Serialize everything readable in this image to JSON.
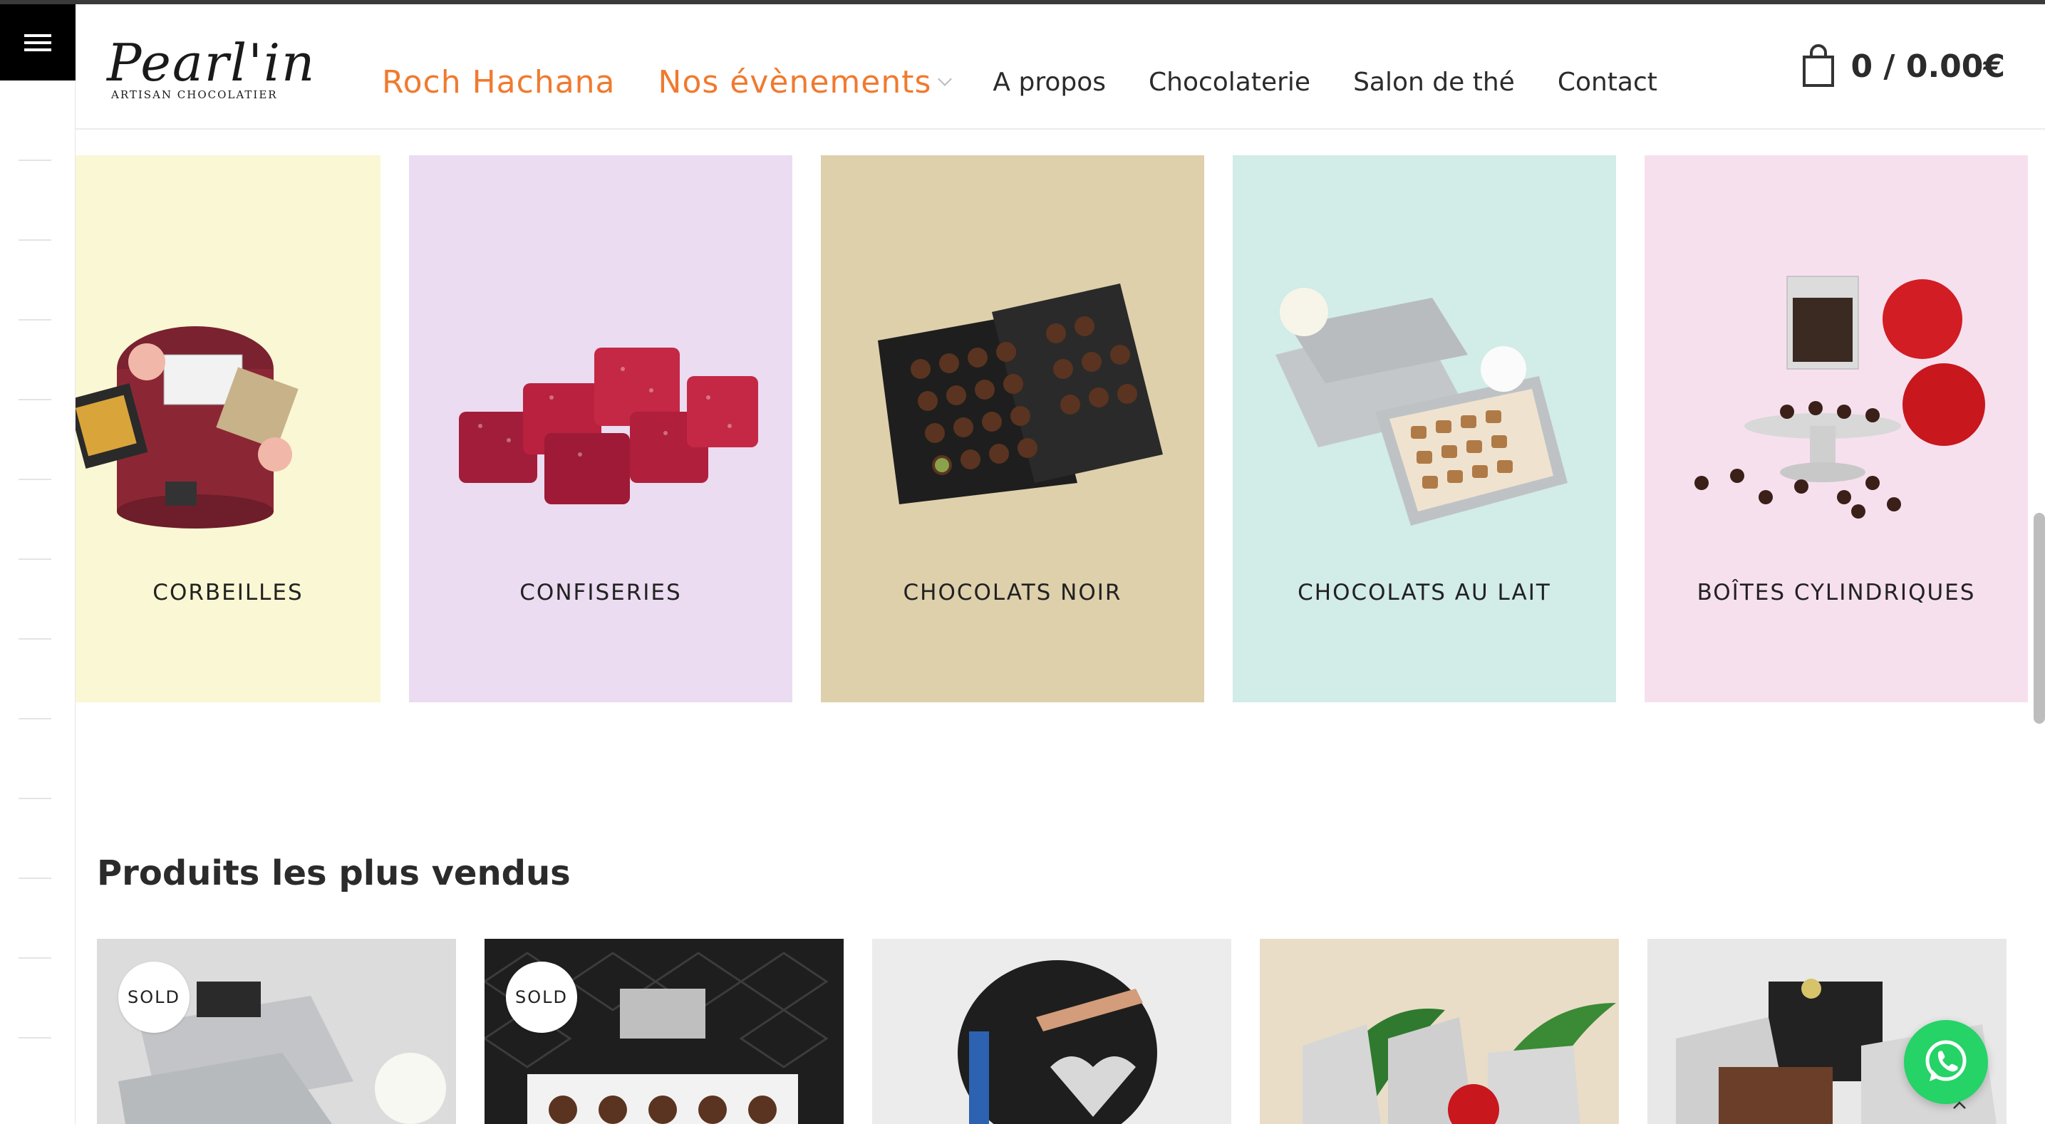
{
  "header": {
    "logo_text": "Pearl'in",
    "logo_subtitle": "ARTISAN CHOCOLATIER",
    "nav": [
      {
        "label": "Roch Hachana",
        "accent": true
      },
      {
        "label": "Nos évènements",
        "accent": true,
        "has_dropdown": true
      },
      {
        "label": "A propos",
        "accent": false
      },
      {
        "label": "Chocolaterie",
        "accent": false
      },
      {
        "label": "Salon de thé",
        "accent": false
      },
      {
        "label": "Contact",
        "accent": false
      }
    ],
    "cart_total": "0 / 0.00€"
  },
  "categories": [
    {
      "label": "CORBEILLES",
      "bg": "#faf7d4"
    },
    {
      "label": "CONFISERIES",
      "bg": "#ebdcf1"
    },
    {
      "label": "CHOCOLATS NOIR",
      "bg": "#ded0ab"
    },
    {
      "label": "CHOCOLATS AU LAIT",
      "bg": "#d2ece8"
    },
    {
      "label": "BOÎTES CYLINDRIQUES",
      "bg": "#f7e0ee"
    }
  ],
  "bestsellers": {
    "title": "Produits les plus vendus",
    "products": [
      {
        "badge": "SOLD",
        "bg": "#d9d9d9"
      },
      {
        "badge": "SOLD",
        "bg": "#2c2c2c"
      },
      {
        "badge": "",
        "bg": "#ececec"
      },
      {
        "badge": "",
        "bg": "#e9ddc8"
      },
      {
        "badge": "",
        "bg": "#e8e8e8"
      }
    ]
  },
  "colors": {
    "accent": "#f07a2f",
    "whatsapp": "#25d366"
  }
}
